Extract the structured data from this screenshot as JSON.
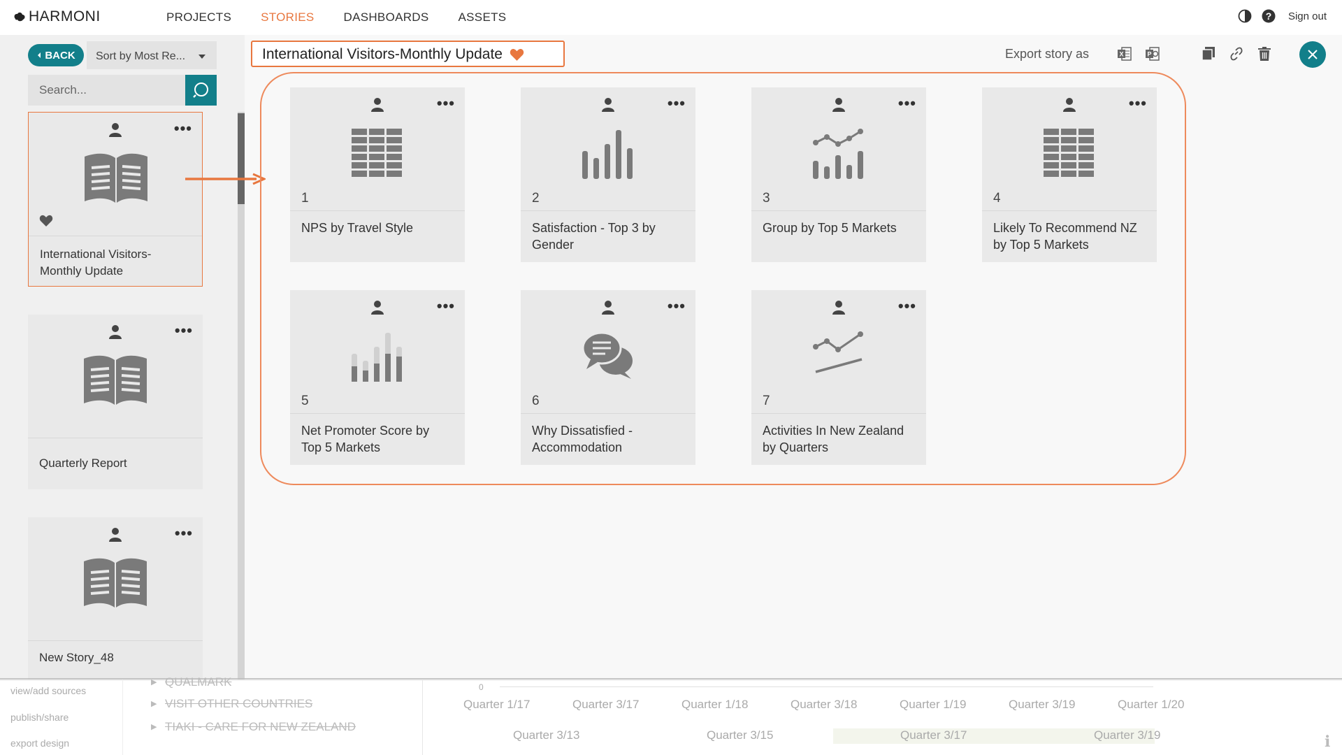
{
  "app": {
    "logo_text": "HARMONI",
    "nav": [
      "PROJECTS",
      "STORIES",
      "DASHBOARDS",
      "ASSETS"
    ],
    "active_nav": "STORIES",
    "sign_out": "Sign out",
    "accent_color": "#e8773f",
    "primary_color": "#127f8a"
  },
  "left": {
    "back_label": "BACK",
    "sort_label": "Sort by Most Re...",
    "search_placeholder": "Search...",
    "stories": [
      {
        "title_line1": "International Visitors-",
        "title_line2": "Monthly Update",
        "favorite": true,
        "selected": true
      },
      {
        "title_line1": "Quarterly Report",
        "title_line2": "",
        "favorite": false,
        "selected": false
      },
      {
        "title_line1": "New Story_48",
        "title_line2": "",
        "favorite": false,
        "selected": false
      }
    ]
  },
  "main": {
    "story_title": "International Visitors-Monthly Update",
    "export_label": "Export story as",
    "pages": [
      {
        "num": "1",
        "line1": "NPS by Travel Style",
        "line2": "",
        "icon": "table-icon"
      },
      {
        "num": "2",
        "line1": "Satisfaction - Top 3 by",
        "line2": "Gender",
        "icon": "bar-chart-icon"
      },
      {
        "num": "3",
        "line1": "Group by Top 5 Markets",
        "line2": "",
        "icon": "combo-chart-icon"
      },
      {
        "num": "4",
        "line1": "Likely To Recommend NZ",
        "line2": "by Top 5 Markets",
        "icon": "table-icon"
      },
      {
        "num": "5",
        "line1": "Net Promoter Score by",
        "line2": "Top 5 Markets",
        "icon": "stacked-bar-icon"
      },
      {
        "num": "6",
        "line1": "Why Dissatisfied -",
        "line2": "Accommodation",
        "icon": "comments-icon"
      },
      {
        "num": "7",
        "line1": "Activities In New Zealand",
        "line2": "by Quarters",
        "icon": "line-chart-icon"
      }
    ]
  },
  "background": {
    "left_links": [
      "view/add sources",
      "publish/share",
      "export design"
    ],
    "tree_items": [
      "QUALMARK",
      "VISIT OTHER COUNTRIES",
      "TIAKI - CARE FOR NEW ZEALAND"
    ],
    "axis_zero": "0",
    "quarters_top": [
      "Quarter 1/17",
      "Quarter 3/17",
      "Quarter 1/18",
      "Quarter 3/18",
      "Quarter 1/19",
      "Quarter 3/19",
      "Quarter 1/20"
    ],
    "quarters_bottom": [
      "Quarter 3/13",
      "Quarter 3/15",
      "Quarter 3/17",
      "Quarter 3/19"
    ]
  }
}
